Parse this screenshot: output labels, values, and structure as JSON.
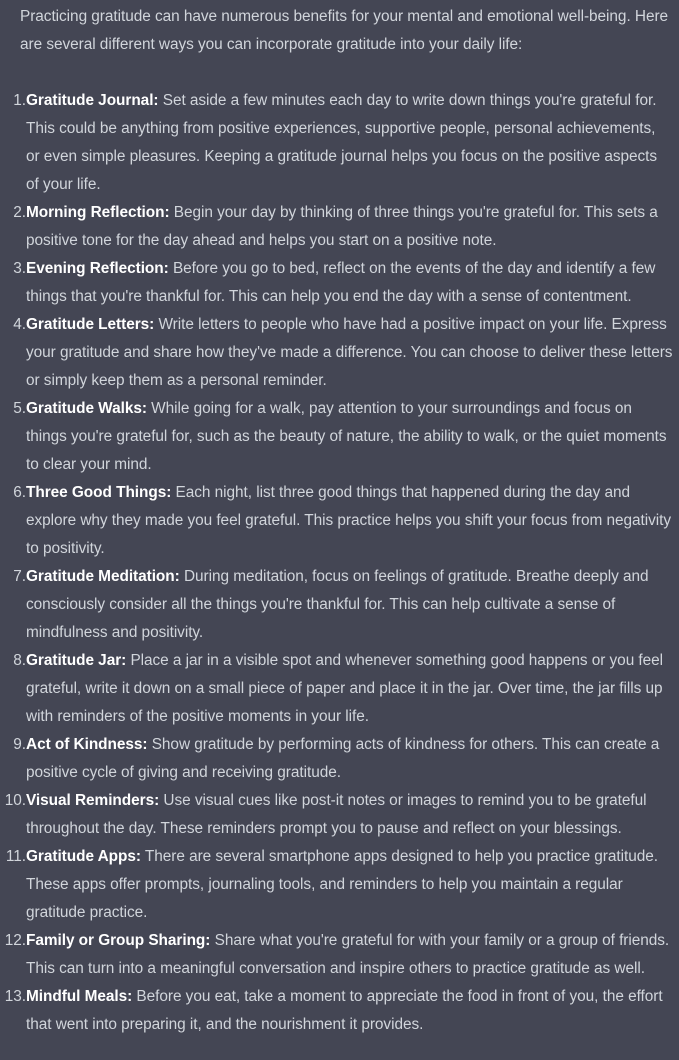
{
  "intro": "Practicing gratitude can have numerous benefits for your mental and emotional well-being. Here are several different ways you can incorporate gratitude into your daily life:",
  "items": [
    {
      "num": "1.",
      "term": "Gratitude Journal:",
      "text": " Set aside a few minutes each day to write down things you're grateful for. This could be anything from positive experiences, supportive people, personal achievements, or even simple pleasures. Keeping a gratitude journal helps you focus on the positive aspects of your life."
    },
    {
      "num": "2.",
      "term": "Morning Reflection:",
      "text": " Begin your day by thinking of three things you're grateful for. This sets a positive tone for the day ahead and helps you start on a positive note."
    },
    {
      "num": "3.",
      "term": "Evening Reflection:",
      "text": " Before you go to bed, reflect on the events of the day and identify a few things that you're thankful for. This can help you end the day with a sense of contentment."
    },
    {
      "num": "4.",
      "term": "Gratitude Letters:",
      "text": " Write letters to people who have had a positive impact on your life. Express your gratitude and share how they've made a difference. You can choose to deliver these letters or simply keep them as a personal reminder."
    },
    {
      "num": "5.",
      "term": "Gratitude Walks:",
      "text": " While going for a walk, pay attention to your surroundings and focus on things you're grateful for, such as the beauty of nature, the ability to walk, or the quiet moments to clear your mind."
    },
    {
      "num": "6.",
      "term": "Three Good Things:",
      "text": " Each night, list three good things that happened during the day and explore why they made you feel grateful. This practice helps you shift your focus from negativity to positivity."
    },
    {
      "num": "7.",
      "term": "Gratitude Meditation:",
      "text": " During meditation, focus on feelings of gratitude. Breathe deeply and consciously consider all the things you're thankful for. This can help cultivate a sense of mindfulness and positivity."
    },
    {
      "num": "8.",
      "term": "Gratitude Jar:",
      "text": " Place a jar in a visible spot and whenever something good happens or you feel grateful, write it down on a small piece of paper and place it in the jar. Over time, the jar fills up with reminders of the positive moments in your life."
    },
    {
      "num": "9.",
      "term": "Act of Kindness:",
      "text": " Show gratitude by performing acts of kindness for others. This can create a positive cycle of giving and receiving gratitude."
    },
    {
      "num": "10.",
      "term": "Visual Reminders:",
      "text": " Use visual cues like post-it notes or images to remind you to be grateful throughout the day. These reminders prompt you to pause and reflect on your blessings."
    },
    {
      "num": "11.",
      "term": "Gratitude Apps:",
      "text": " There are several smartphone apps designed to help you practice gratitude. These apps offer prompts, journaling tools, and reminders to help you maintain a regular gratitude practice."
    },
    {
      "num": "12.",
      "term": "Family or Group Sharing:",
      "text": " Share what you're grateful for with your family or a group of friends. This can turn into a meaningful conversation and inspire others to practice gratitude as well."
    },
    {
      "num": "13.",
      "term": "Mindful Meals:",
      "text": " Before you eat, take a moment to appreciate the food in front of you, the effort that went into preparing it, and the nourishment it provides."
    }
  ],
  "colors": {
    "background": "#444654",
    "text": "#d1d5db",
    "term": "#ffffff"
  }
}
